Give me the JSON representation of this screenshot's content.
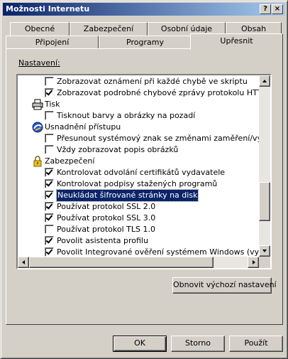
{
  "window": {
    "title": "Možnosti Internetu",
    "help_button": "?",
    "close_button": "×"
  },
  "tabs_row_back": [
    "Obecné",
    "Zabezpečení",
    "Osobní údaje",
    "Obsah"
  ],
  "tabs_row_front": [
    "Připojení",
    "Programy",
    "Upřesnit"
  ],
  "active_tab": "Upřesnit",
  "settings": {
    "label": "Nastavení:",
    "items": [
      {
        "kind": "option",
        "label": "Zobrazovat oznámení při každé chybě ve skriptu",
        "checked": false
      },
      {
        "kind": "option",
        "label": "Zobrazovat podrobné chybové zprávy protokolu HTTP",
        "checked": true
      },
      {
        "kind": "category",
        "label": "Tisk",
        "icon": "printer-icon"
      },
      {
        "kind": "option",
        "label": "Tisknout barvy a obrázky na pozadí",
        "checked": false
      },
      {
        "kind": "category",
        "label": "Usnadnění přístupu",
        "icon": "accessibility-icon"
      },
      {
        "kind": "option",
        "label": "Přesunout systémový znak se změnami zaměření/výběru",
        "checked": false
      },
      {
        "kind": "option",
        "label": "Vždy zobrazovat popis obrázků",
        "checked": false
      },
      {
        "kind": "category",
        "label": "Zabezpečení",
        "icon": "lock-icon"
      },
      {
        "kind": "option",
        "label": "Kontrolovat odvolání certifikátů vydavatele",
        "checked": true
      },
      {
        "kind": "option",
        "label": "Kontrolovat podpisy stažených programů",
        "checked": true
      },
      {
        "kind": "option",
        "label": "Neukládat šifrované stránky na disk",
        "checked": true,
        "selected": true
      },
      {
        "kind": "option",
        "label": "Používat protokol SSL 2.0",
        "checked": true
      },
      {
        "kind": "option",
        "label": "Používat protokol SSL 3.0",
        "checked": true
      },
      {
        "kind": "option",
        "label": "Používat protokol TLS 1.0",
        "checked": false
      },
      {
        "kind": "option",
        "label": "Povolit asistenta profilu",
        "checked": true
      },
      {
        "kind": "option",
        "label": "Povolit Integrované ověření systémem Windows (vyžaduje res",
        "checked": true
      }
    ]
  },
  "restore_button": "Obnovit výchozí nastavení",
  "footer": {
    "ok": "OK",
    "cancel": "Storno",
    "apply": "Použít"
  },
  "scroll": {
    "vertical_position_fraction": 0.8,
    "horizontal_position_fraction": 0.0
  }
}
